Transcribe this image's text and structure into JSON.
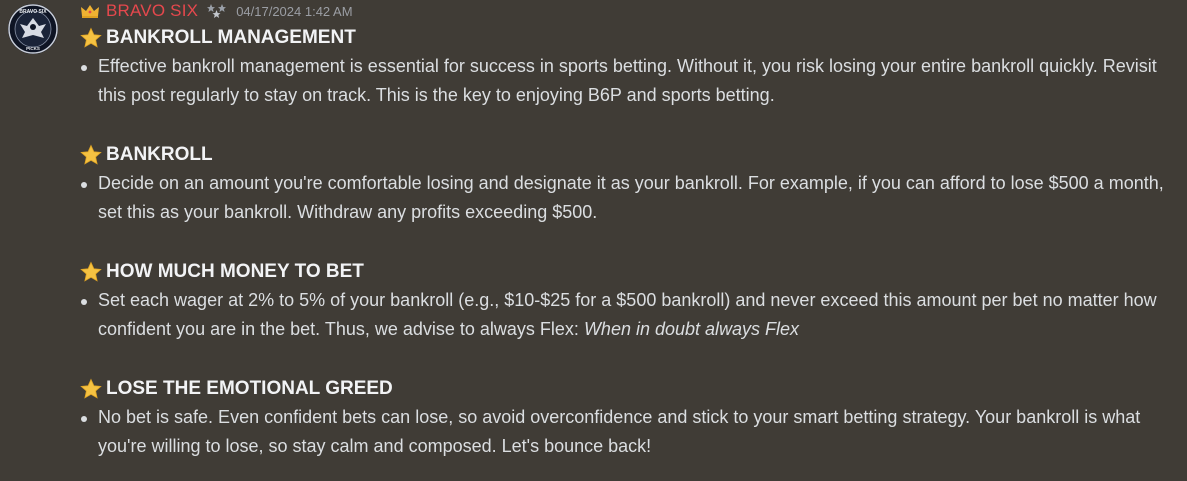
{
  "message": {
    "username": "BRAVO SIX",
    "timestamp": "04/17/2024 1:42 AM",
    "colors": {
      "username": "#e5484d",
      "background": "#403c36",
      "text": "#dbdee1"
    },
    "icons": {
      "avatar": "bravo-six-picks-eagle-logo",
      "role": "crown-icon",
      "badge": "stars-badge-icon",
      "bullet-heading": "star-icon"
    },
    "avatar_text": {
      "top": "BRAVO SIX",
      "bottom": "PICKS"
    }
  },
  "sections": [
    {
      "title": "BANKROLL MANAGEMENT",
      "text": "Effective bankroll management is essential for success in sports betting. Without it, you risk losing your entire bankroll quickly. Revisit this post regularly to stay on track. This is the key to enjoying B6P and sports betting."
    },
    {
      "title": "BANKROLL",
      "text": "Decide on an amount you're comfortable losing and designate it as your bankroll. For example, if you can afford to lose $500 a month, set this as your bankroll. Withdraw any profits exceeding $500."
    },
    {
      "title": "HOW MUCH MONEY TO BET",
      "text": "Set each wager at 2% to 5% of your bankroll (e.g., $10-$25 for a $500 bankroll) and never exceed this amount per bet no matter how confident you are in the bet. Thus, we advise to always Flex: ",
      "emphasis": "When in doubt always Flex"
    },
    {
      "title": "LOSE THE EMOTIONAL GREED",
      "text": "No bet is safe. Even confident bets can lose, so avoid overconfidence and stick to your smart betting strategy. Your bankroll is what you're willing to lose, so stay calm and composed. Let's bounce back!"
    }
  ]
}
